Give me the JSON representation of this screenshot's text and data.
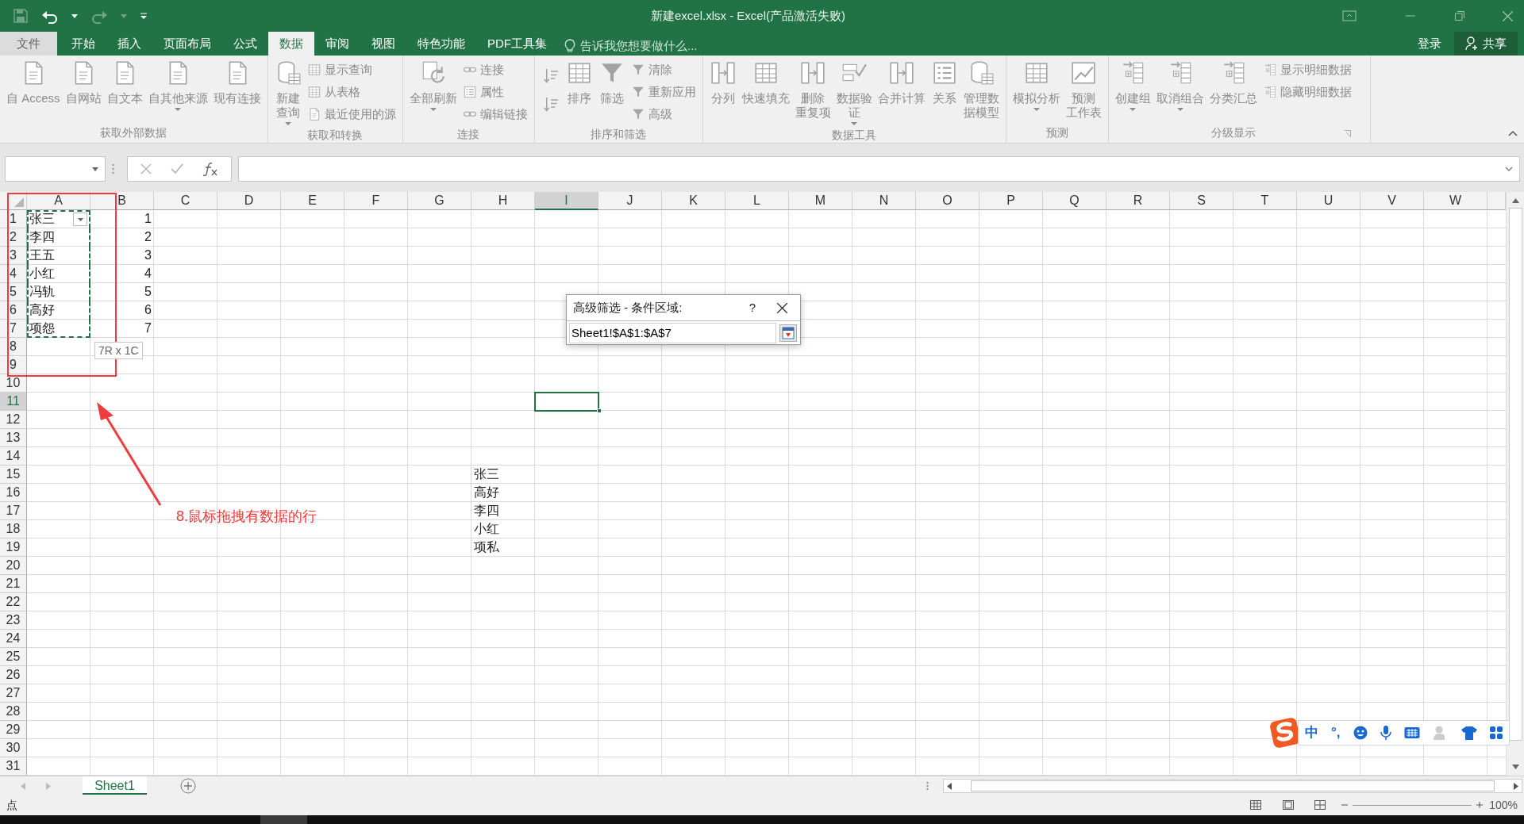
{
  "title_bar": {
    "title": "新建excel.xlsx - Excel(产品激活失败)"
  },
  "menu_tabs": [
    {
      "label": "文件",
      "kind": "file",
      "selected": false
    },
    {
      "label": "开始",
      "kind": "tab",
      "selected": false
    },
    {
      "label": "插入",
      "kind": "tab",
      "selected": false
    },
    {
      "label": "页面布局",
      "kind": "tab",
      "selected": false
    },
    {
      "label": "公式",
      "kind": "tab",
      "selected": false
    },
    {
      "label": "数据",
      "kind": "tab",
      "selected": true
    },
    {
      "label": "审阅",
      "kind": "tab",
      "selected": false
    },
    {
      "label": "视图",
      "kind": "tab",
      "selected": false
    },
    {
      "label": "特色功能",
      "kind": "tab",
      "selected": false
    },
    {
      "label": "PDF工具集",
      "kind": "tab",
      "selected": false
    }
  ],
  "tell_me": {
    "placeholder": "告诉我您想要做什么..."
  },
  "account": {
    "sign_in": "登录",
    "share": "共享"
  },
  "ribbon": {
    "disabled": true,
    "groups": [
      {
        "label": "获取外部数据",
        "items": [
          {
            "kind": "large",
            "lines": [
              "自 Access"
            ],
            "dropdown": false
          },
          {
            "kind": "large",
            "lines": [
              "自网站"
            ],
            "dropdown": false
          },
          {
            "kind": "large",
            "lines": [
              "自文本"
            ],
            "dropdown": false
          },
          {
            "kind": "large",
            "lines": [
              "自其他来源"
            ],
            "dropdown": true
          },
          {
            "kind": "large",
            "lines": [
              "现有连接"
            ],
            "dropdown": false
          }
        ]
      },
      {
        "label": "获取和转换",
        "items": [
          {
            "kind": "large",
            "lines": [
              "新建",
              "查询"
            ],
            "dropdown": true
          },
          {
            "kind": "small",
            "label": "显示查询",
            "dropdown": false
          },
          {
            "kind": "small",
            "label": "从表格",
            "dropdown": false
          },
          {
            "kind": "small",
            "label": "最近使用的源",
            "dropdown": false
          }
        ]
      },
      {
        "label": "连接",
        "items": [
          {
            "kind": "large",
            "lines": [
              "全部刷新"
            ],
            "dropdown": true
          },
          {
            "kind": "small",
            "label": "连接",
            "dropdown": false
          },
          {
            "kind": "small",
            "label": "属性",
            "dropdown": false
          },
          {
            "kind": "small",
            "label": "编辑链接",
            "dropdown": false
          }
        ]
      },
      {
        "label": "排序和筛选",
        "items": [
          {
            "kind": "icon",
            "dropdown": false
          },
          {
            "kind": "icon",
            "dropdown": false
          },
          {
            "kind": "large",
            "lines": [
              "排序"
            ],
            "dropdown": false
          },
          {
            "kind": "large",
            "lines": [
              "筛选"
            ],
            "dropdown": false
          },
          {
            "kind": "small",
            "label": "清除",
            "dropdown": false
          },
          {
            "kind": "small",
            "label": "重新应用",
            "dropdown": false
          },
          {
            "kind": "small",
            "label": "高级",
            "dropdown": false
          }
        ]
      },
      {
        "label": "数据工具",
        "items": [
          {
            "kind": "large",
            "lines": [
              "分列"
            ],
            "dropdown": false
          },
          {
            "kind": "large",
            "lines": [
              "快速填充"
            ],
            "dropdown": false
          },
          {
            "kind": "large",
            "lines": [
              "删除",
              "重复项"
            ],
            "dropdown": false
          },
          {
            "kind": "large",
            "lines": [
              "数据验",
              "证"
            ],
            "dropdown": true
          },
          {
            "kind": "large",
            "lines": [
              "合并计算"
            ],
            "dropdown": false
          },
          {
            "kind": "large",
            "lines": [
              "关系"
            ],
            "dropdown": false
          },
          {
            "kind": "large",
            "lines": [
              "管理数",
              "据模型"
            ],
            "dropdown": false
          }
        ]
      },
      {
        "label": "预测",
        "items": [
          {
            "kind": "large",
            "lines": [
              "模拟分析"
            ],
            "dropdown": true
          },
          {
            "kind": "large",
            "lines": [
              "预测",
              "工作表"
            ],
            "dropdown": false
          }
        ]
      },
      {
        "label": "分级显示",
        "items": [
          {
            "kind": "large",
            "lines": [
              "创建组"
            ],
            "dropdown": true
          },
          {
            "kind": "large",
            "lines": [
              "取消组合"
            ],
            "dropdown": true
          },
          {
            "kind": "large",
            "lines": [
              "分类汇总"
            ],
            "dropdown": false
          },
          {
            "kind": "small",
            "label": "显示明细数据",
            "dropdown": false
          },
          {
            "kind": "small",
            "label": "隐藏明细数据",
            "dropdown": false
          }
        ]
      }
    ]
  },
  "sheet": {
    "columns": [
      {
        "label": "A",
        "selected": false
      },
      {
        "label": "B",
        "selected": false
      },
      {
        "label": "C",
        "selected": false
      },
      {
        "label": "D",
        "selected": false
      },
      {
        "label": "E",
        "selected": false
      },
      {
        "label": "F",
        "selected": false
      },
      {
        "label": "G",
        "selected": false
      },
      {
        "label": "H",
        "selected": false
      },
      {
        "label": "I",
        "selected": true
      },
      {
        "label": "J",
        "selected": false
      },
      {
        "label": "K",
        "selected": false
      },
      {
        "label": "L",
        "selected": false
      },
      {
        "label": "M",
        "selected": false
      },
      {
        "label": "N",
        "selected": false
      },
      {
        "label": "O",
        "selected": false
      },
      {
        "label": "P",
        "selected": false
      },
      {
        "label": "Q",
        "selected": false
      },
      {
        "label": "R",
        "selected": false
      },
      {
        "label": "S",
        "selected": false
      },
      {
        "label": "T",
        "selected": false
      },
      {
        "label": "U",
        "selected": false
      },
      {
        "label": "V",
        "selected": false
      },
      {
        "label": "W",
        "selected": false
      }
    ],
    "rows": [
      {
        "label": "1",
        "selected": false,
        "cells": {
          "A": {
            "text": "张三",
            "kind": "text",
            "in_range": true,
            "filter_button": true
          },
          "B": {
            "text": "1",
            "kind": "number",
            "in_range": false,
            "filter_button": false
          }
        }
      },
      {
        "label": "2",
        "selected": false,
        "cells": {
          "A": {
            "text": "李四",
            "kind": "text",
            "in_range": true,
            "filter_button": false
          },
          "B": {
            "text": "2",
            "kind": "number",
            "in_range": false,
            "filter_button": false
          }
        }
      },
      {
        "label": "3",
        "selected": false,
        "cells": {
          "A": {
            "text": "王五",
            "kind": "text",
            "in_range": true,
            "filter_button": false
          },
          "B": {
            "text": "3",
            "kind": "number",
            "in_range": false,
            "filter_button": false
          }
        }
      },
      {
        "label": "4",
        "selected": false,
        "cells": {
          "A": {
            "text": "小红",
            "kind": "text",
            "in_range": true,
            "filter_button": false
          },
          "B": {
            "text": "4",
            "kind": "number",
            "in_range": false,
            "filter_button": false
          }
        }
      },
      {
        "label": "5",
        "selected": false,
        "cells": {
          "A": {
            "text": "冯轨",
            "kind": "text",
            "in_range": true,
            "filter_button": false
          },
          "B": {
            "text": "5",
            "kind": "number",
            "in_range": false,
            "filter_button": false
          }
        }
      },
      {
        "label": "6",
        "selected": false,
        "cells": {
          "A": {
            "text": "高好",
            "kind": "text",
            "in_range": true,
            "filter_button": false
          },
          "B": {
            "text": "6",
            "kind": "number",
            "in_range": false,
            "filter_button": false
          }
        }
      },
      {
        "label": "7",
        "selected": false,
        "cells": {
          "A": {
            "text": "项怨",
            "kind": "text",
            "in_range": true,
            "filter_button": false
          },
          "B": {
            "text": "7",
            "kind": "number",
            "in_range": false,
            "filter_button": false
          }
        }
      },
      {
        "label": "8",
        "selected": false
      },
      {
        "label": "9",
        "selected": false
      },
      {
        "label": "10",
        "selected": false
      },
      {
        "label": "11",
        "selected": true
      },
      {
        "label": "12",
        "selected": false
      },
      {
        "label": "13",
        "selected": false
      },
      {
        "label": "14",
        "selected": false
      },
      {
        "label": "15",
        "selected": false,
        "cells": {
          "H": {
            "text": "张三",
            "kind": "text",
            "in_range": false,
            "filter_button": false
          }
        }
      },
      {
        "label": "16",
        "selected": false,
        "cells": {
          "H": {
            "text": "高好",
            "kind": "text",
            "in_range": false,
            "filter_button": false
          }
        }
      },
      {
        "label": "17",
        "selected": false,
        "cells": {
          "H": {
            "text": "李四",
            "kind": "text",
            "in_range": false,
            "filter_button": false
          }
        }
      },
      {
        "label": "18",
        "selected": false,
        "cells": {
          "H": {
            "text": "小红",
            "kind": "text",
            "in_range": false,
            "filter_button": false
          }
        }
      },
      {
        "label": "19",
        "selected": false,
        "cells": {
          "H": {
            "text": "项私",
            "kind": "text",
            "in_range": false,
            "filter_button": false
          }
        }
      },
      {
        "label": "20",
        "selected": false
      },
      {
        "label": "21",
        "selected": false
      },
      {
        "label": "22",
        "selected": false
      },
      {
        "label": "23",
        "selected": false
      },
      {
        "label": "24",
        "selected": false
      },
      {
        "label": "25",
        "selected": false
      },
      {
        "label": "26",
        "selected": false
      },
      {
        "label": "27",
        "selected": false
      },
      {
        "label": "28",
        "selected": false
      },
      {
        "label": "29",
        "selected": false
      },
      {
        "label": "30",
        "selected": false
      },
      {
        "label": "31",
        "selected": false
      }
    ]
  },
  "range_tooltip": "7R x 1C",
  "annotation": {
    "text": "8.鼠标拖拽有数据的行"
  },
  "dialog": {
    "title": "高级筛选 - 条件区域:",
    "help": "?",
    "value": "Sheet1!$A$1:$A$7"
  },
  "ime_toolbar": {
    "mode": "中",
    "punctuation": "°,"
  },
  "sheet_tabs": [
    {
      "label": "Sheet1",
      "selected": true
    }
  ],
  "status_bar": {
    "mode": "点",
    "zoom": "100%"
  }
}
